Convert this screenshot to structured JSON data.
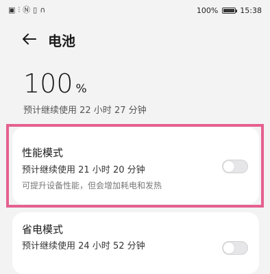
{
  "status_bar": {
    "left_icons": [
      "sim-icon",
      "wifi-icon",
      "nfc-icon",
      "vibrate-icon",
      "headphones-icon"
    ],
    "battery_text": "100%",
    "battery_level": 1.0,
    "time": "15:38"
  },
  "header": {
    "title": "电池"
  },
  "battery": {
    "percent": "100",
    "unit": "%",
    "estimate": "预计继续使用 22 小时 27 分钟"
  },
  "modes": [
    {
      "title": "性能模式",
      "estimate": "预计继续使用 21 小时 20 分钟",
      "description": "可提升设备性能，但会增加耗电和发热",
      "enabled": false
    },
    {
      "title": "省电模式",
      "estimate": "预计继续使用 24 小时 52 分钟",
      "enabled": false
    }
  ],
  "colors": {
    "highlight": "#e5608f",
    "toggle_off": "#e6e6e8"
  }
}
